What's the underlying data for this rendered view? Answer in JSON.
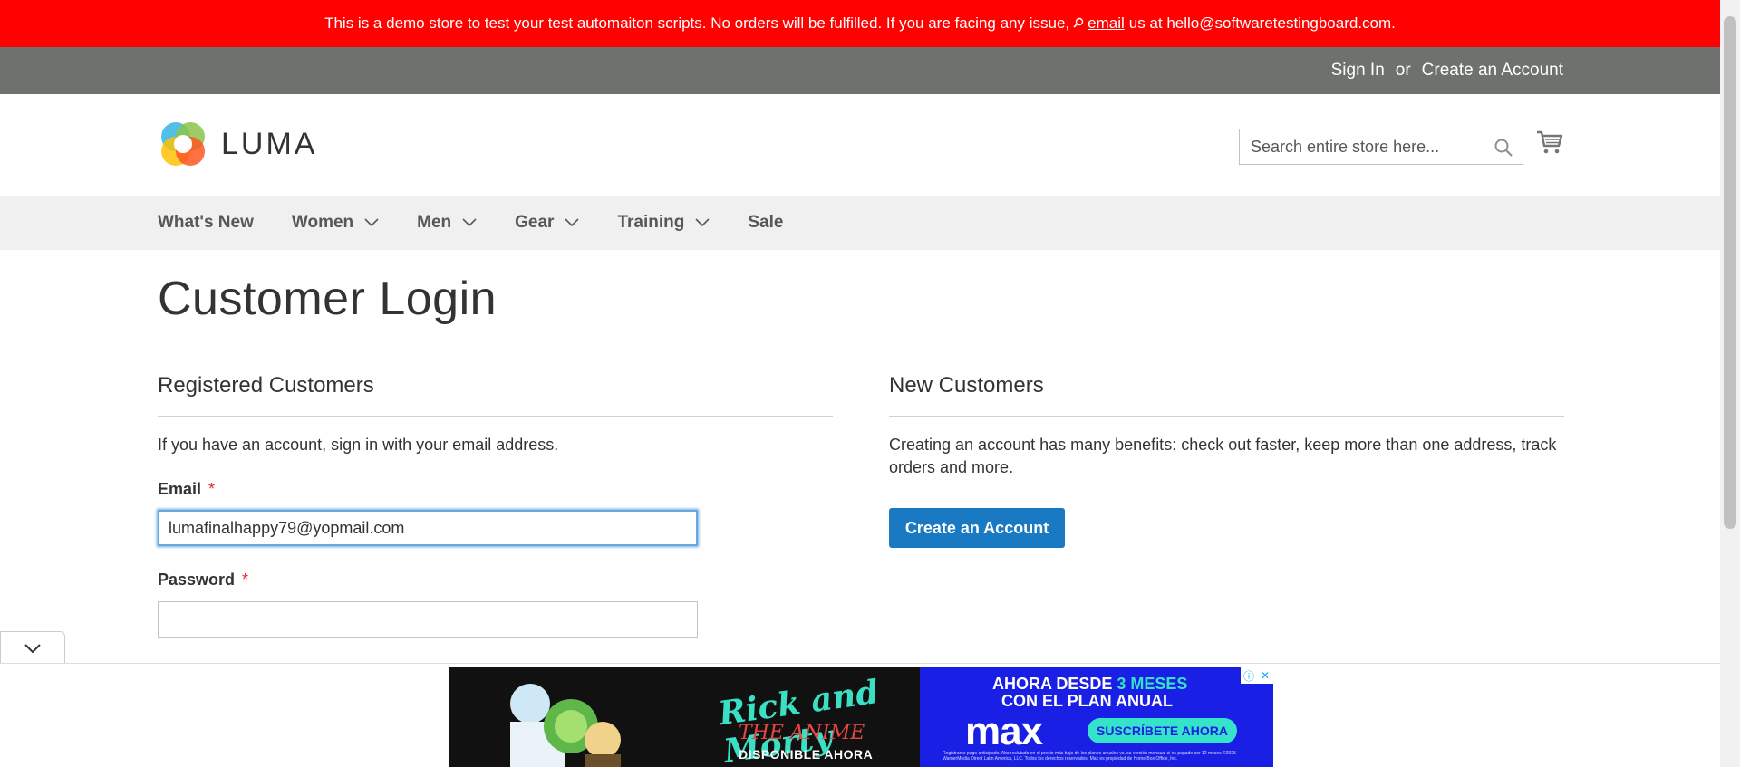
{
  "demo_banner": {
    "text_before": "This is a demo store to test your test automaiton scripts. No orders will be fulfilled. If you are facing any issue,",
    "email_link": "email",
    "text_after": "us at hello@softwaretestingboard.com."
  },
  "header_links": {
    "sign_in": "Sign In",
    "or": "or",
    "create_account": "Create an Account"
  },
  "logo": {
    "text": "LUMA"
  },
  "search": {
    "placeholder": "Search entire store here..."
  },
  "nav": {
    "items": [
      {
        "label": "What's New"
      },
      {
        "label": "Women"
      },
      {
        "label": "Men"
      },
      {
        "label": "Gear"
      },
      {
        "label": "Training"
      },
      {
        "label": "Sale"
      }
    ]
  },
  "page": {
    "title": "Customer Login"
  },
  "registered": {
    "title": "Registered Customers",
    "intro": "If you have an account, sign in with your email address.",
    "email_label": "Email",
    "email_value": "lumafinalhappy79@yopmail.com",
    "password_label": "Password",
    "required_mark": "*"
  },
  "new_customers": {
    "title": "New Customers",
    "intro": "Creating an account has many benefits: check out faster, keep more than one address, track orders and more.",
    "button": "Create an Account"
  },
  "ad": {
    "title": "Rick and Morty",
    "subtitle": "THE ANIME",
    "cta_left": "DISPONIBLE AHORA",
    "line1_a": "AHORA DESDE",
    "line1_b": "3 MESES",
    "line2": "CON EL PLAN ANUAL",
    "brand": "max",
    "cta": "SUSCRÍBETE AHORA",
    "legal": "Registrarse pago anticipado. Aboneclutado en el precio más bajo de los planes anuales vs. su versión mensual si es pagado por 12 meses ©2025 WarnerMedia Direct Latin America, LLC. Todos los derechos reservados. Max es propiedad de Home Box Office, Inc."
  },
  "colors": {
    "banner_red": "#ff0101",
    "panel_gray": "#6e716e",
    "nav_bg": "#f0f0f0",
    "primary_blue": "#1979c3",
    "required_red": "#e02b27"
  }
}
